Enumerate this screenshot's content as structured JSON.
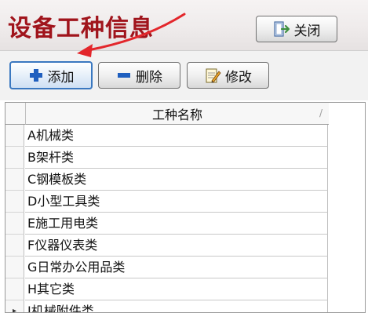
{
  "window": {
    "title": "设备工种信息",
    "close_label": "关闭"
  },
  "toolbar": {
    "add_label": "添加",
    "delete_label": "删除",
    "edit_label": "修改"
  },
  "grid": {
    "column_header": "工种名称",
    "rows": [
      "A机械类",
      "B架杆类",
      "C钢模板类",
      "D小型工具类",
      "E施工用电类",
      "F仪器仪表类",
      "G日常办公用品类",
      "H其它类",
      "I机械附件类"
    ],
    "current_row_index": 8
  },
  "colors": {
    "title": "#a0141c",
    "annotation_arrow": "#e3262b",
    "add_icon": "#1f5fbf",
    "delete_icon": "#1f5fbf"
  }
}
